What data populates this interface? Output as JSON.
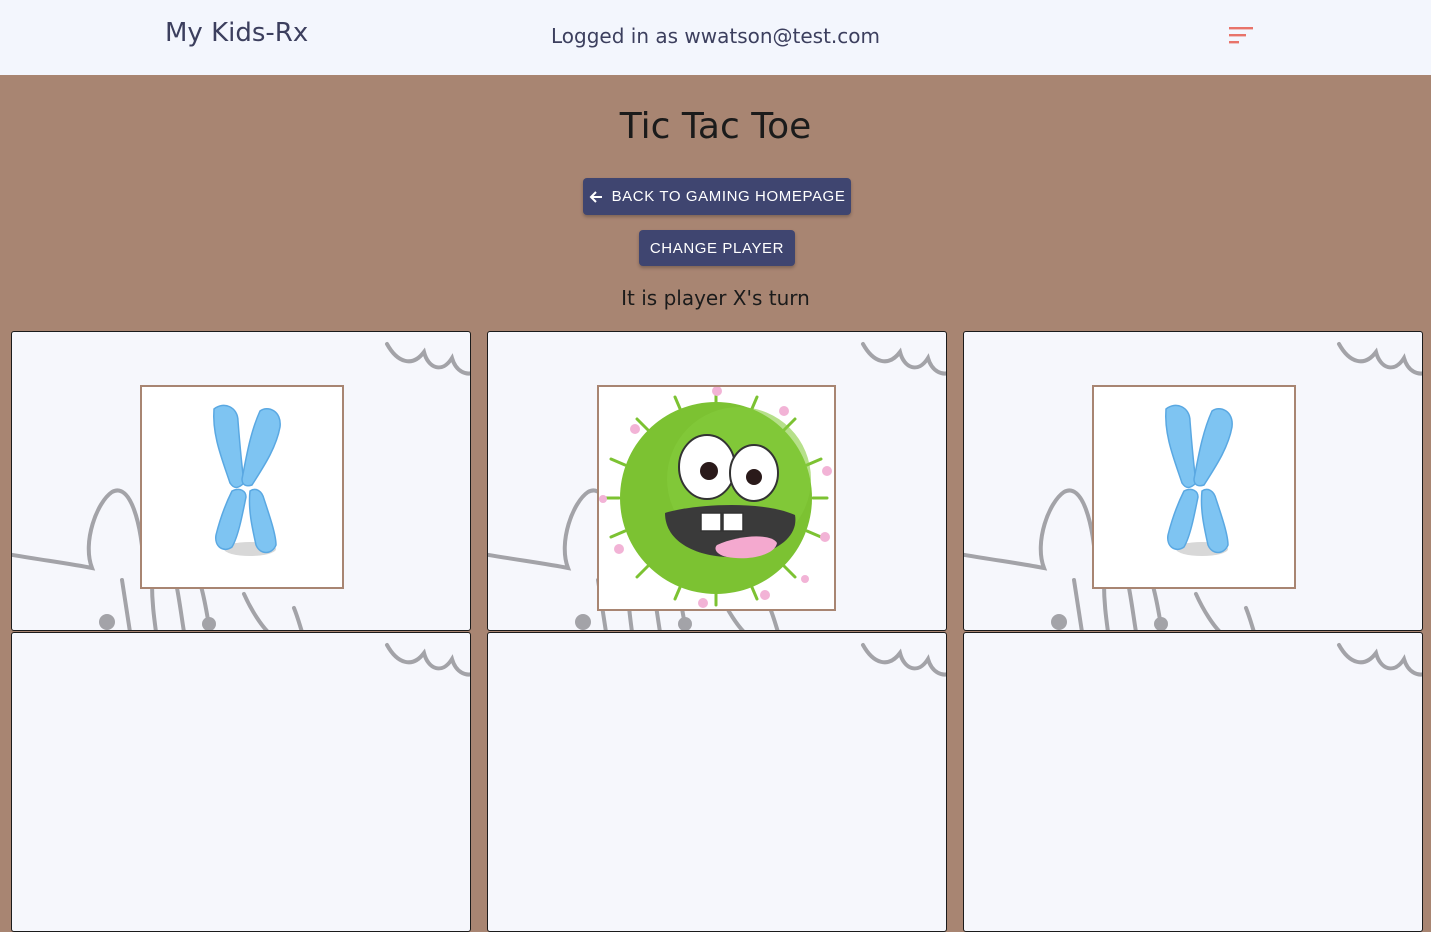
{
  "header": {
    "brand": "My Kids-Rx",
    "login_status": "Logged in as wwatson@test.com",
    "menu_icon": "sort-menu-icon",
    "menu_color": "#e8736a"
  },
  "page": {
    "title": "Tic Tac Toe",
    "back_button_label": "Back to Gaming Homepage",
    "change_player_label": "Change Player",
    "turn_status": "It is player X's turn"
  },
  "colors": {
    "background": "#a88572",
    "navbar": "#f3f6fd",
    "button": "#3f4570",
    "chromosome": "#7ec4f2",
    "germ": "#7cc232"
  },
  "board": {
    "cells": [
      {
        "piece": "X",
        "icon": "chromosome-x-icon"
      },
      {
        "piece": "O",
        "icon": "green-germ-icon"
      },
      {
        "piece": "X",
        "icon": "chromosome-x-icon"
      }
    ]
  }
}
